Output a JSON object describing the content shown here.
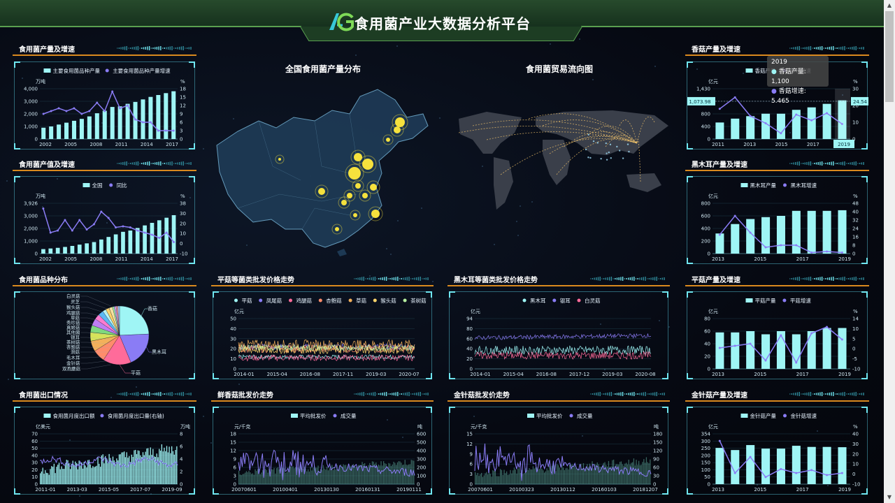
{
  "header": {
    "title": "食用菌产业大数据分析平台"
  },
  "colors": {
    "bar": "#9ff5f5",
    "line": "#8a7cf5",
    "accent": "#d9891e",
    "panel": "#5ad2e6"
  },
  "maps": {
    "china_title": "全国食用菌产量分布",
    "world_title": "食用菌贸易流向图"
  },
  "tooltip": {
    "year": "2019",
    "l1": "香菇产量: 1,100",
    "l2": "香菇增速: 5.465"
  },
  "chart_data": [
    {
      "id": "p1",
      "type": "bar",
      "section": "食用菌产量及增速",
      "legend": [
        "主要食用菌品种产量",
        "主要食用菌品种产量增速"
      ],
      "ylabel_left": "万吨",
      "ylabel_right": "%",
      "ymax": 4000,
      "yticks": [
        "4,000",
        "3,000",
        "2,000",
        "1,000",
        "0"
      ],
      "y2ticks": [
        "18",
        "15",
        "12",
        "9",
        "6",
        "3",
        "0"
      ],
      "y2min": 0,
      "y2max": 18,
      "xticks": [
        "2002",
        "2005",
        "2008",
        "2011",
        "2014",
        "2017"
      ],
      "bars": [
        900,
        1000,
        1150,
        1300,
        1450,
        1600,
        1800,
        2050,
        2250,
        2550,
        2600,
        2800,
        2950,
        3150,
        3350,
        3500,
        3650,
        3800
      ],
      "line": [
        9,
        10,
        11,
        10,
        11,
        9,
        10,
        13,
        10,
        17,
        11,
        12,
        7,
        6,
        6,
        3,
        3,
        3
      ]
    },
    {
      "id": "p2",
      "type": "bar",
      "section": "食用菌产值及增速",
      "legend": [
        "全国",
        "同比"
      ],
      "ylabel_left": "万吨",
      "ylabel_right": "%",
      "ymax": 3926,
      "yticks": [
        "3,926",
        "3,000",
        "2,000",
        "1,000",
        "0"
      ],
      "y2ticks": [
        "38",
        "30",
        "20",
        "10",
        "0",
        "-10"
      ],
      "y2min": -10,
      "y2max": 38,
      "xticks": [
        "2002",
        "2005",
        "2008",
        "2011",
        "2014",
        "2017"
      ],
      "bars": [
        350,
        400,
        450,
        520,
        600,
        700,
        800,
        900,
        1100,
        1300,
        1500,
        1700,
        1800,
        2000,
        2200,
        2400,
        2600,
        2800,
        3000
      ],
      "line": [
        33,
        10,
        12,
        22,
        12,
        22,
        13,
        18,
        30,
        24,
        15,
        16,
        15,
        12,
        10,
        8,
        5,
        10,
        1
      ]
    },
    {
      "id": "p3",
      "type": "bar",
      "section": "香菇产量及增速",
      "legend": [
        "香菇产量",
        "香菇增速"
      ],
      "ylabel_left": "亿元",
      "ylabel_right": "%",
      "ymax": 1430,
      "yticks": [
        "1,430",
        "1,200",
        "800",
        "400",
        "0"
      ],
      "y2ticks": [
        "30",
        "20",
        "10",
        "0"
      ],
      "y2min": -5,
      "y2max": 30,
      "xticks": [
        "2011",
        "2013",
        "2015",
        "2017",
        "2019"
      ],
      "bars": [
        470,
        580,
        650,
        720,
        720,
        830,
        900,
        1000,
        1100
      ],
      "line": [
        16,
        24,
        11,
        6,
        -1,
        12,
        8,
        13,
        5.465
      ],
      "marks": [
        "1,073.98",
        "24.54",
        "2019"
      ]
    },
    {
      "id": "p4",
      "type": "bar",
      "section": "黑木耳产量及增速",
      "legend": [
        "黑木耳产量",
        "黑木耳增速"
      ],
      "ylabel_left": "亿元",
      "ylabel_right": "%",
      "ymax": 800,
      "yticks": [
        "800",
        "600",
        "400",
        "200",
        "0"
      ],
      "y2ticks": [
        "48",
        "40",
        "32",
        "24",
        "16",
        "8",
        "0"
      ],
      "y2min": 0,
      "y2max": 48,
      "xticks": [
        "2013",
        "2015",
        "2017",
        "2019"
      ],
      "bars": [
        320,
        470,
        550,
        580,
        600,
        680,
        680,
        680,
        690
      ],
      "line": [
        18,
        36,
        20,
        6,
        8,
        8,
        1,
        2,
        1
      ]
    },
    {
      "id": "p5",
      "type": "bar",
      "section": "平菇产量及增速",
      "legend": [
        "平菇产量",
        "平菇增速"
      ],
      "ylabel_left": "亿元",
      "ylabel_right": "%",
      "ymax": 80,
      "yticks": [
        "80",
        "60",
        "40",
        "20",
        "0"
      ],
      "y2ticks": [
        "14",
        "10",
        "5",
        "0",
        "-5",
        "-10"
      ],
      "y2min": -10,
      "y2max": 14,
      "xticks": [
        "2013",
        "2015",
        "2017",
        "2019"
      ],
      "bars": [
        58,
        58,
        60,
        55,
        60,
        55,
        60,
        65,
        65
      ],
      "line": [
        0,
        1,
        2,
        -6,
        6,
        -7,
        7,
        10,
        4
      ]
    },
    {
      "id": "p6",
      "type": "bar",
      "section": "金针菇产量及增速",
      "legend": [
        "金针菇产量",
        "金针菇增速"
      ],
      "ylabel_left": "亿元",
      "ylabel_right": "%",
      "ymax": 354,
      "yticks": [
        "354",
        "300",
        "250",
        "200",
        "150",
        "100",
        "50",
        "0"
      ],
      "y2ticks": [
        "40",
        "30",
        "20",
        "10",
        "0",
        "-10"
      ],
      "y2min": -10,
      "y2max": 40,
      "xticks": [
        "2013",
        "2015",
        "2017",
        "2019"
      ],
      "bars": [
        255,
        240,
        275,
        250,
        250,
        270,
        262,
        262,
        260
      ],
      "line": [
        33,
        1,
        17,
        -3,
        5,
        1,
        4,
        -1,
        1
      ]
    },
    {
      "id": "p7",
      "type": "pie",
      "section": "食用菌品种分布",
      "slices": [
        {
          "n": "香菇",
          "v": 25,
          "c": "#9ff5f5"
        },
        {
          "n": "黑木耳",
          "v": 20,
          "c": "#8a7cf5"
        },
        {
          "n": "平菇",
          "v": 16,
          "c": "#ff6b9a"
        },
        {
          "n": "双孢蘑菇",
          "v": 7,
          "c": "#ff8c6b"
        },
        {
          "n": "金针菇",
          "v": 6,
          "c": "#f3b05a"
        },
        {
          "n": "毛木耳",
          "v": 5,
          "c": "#d6e35a"
        },
        {
          "n": "滑菇",
          "v": 4,
          "c": "#7fd97f"
        },
        {
          "n": "杏鲍菇",
          "v": 4,
          "c": "#c07cf5"
        },
        {
          "n": "茶树菇",
          "v": 3,
          "c": "#ff7bd1"
        },
        {
          "n": "银耳",
          "v": 3,
          "c": "#5ab8f5"
        },
        {
          "n": "秀珍菇",
          "v": 2,
          "c": "#b7f5f5"
        },
        {
          "n": "草菇",
          "v": 2,
          "c": "#ffd56b"
        },
        {
          "n": "真姬菇",
          "v": 2,
          "c": "#f5e2a0"
        },
        {
          "n": "鸡腿菇",
          "v": 1,
          "c": "#a0f5b7"
        },
        {
          "n": "猴头菇",
          "v": 1,
          "c": "#d0a0f5"
        },
        {
          "n": "灵芝",
          "v": 1,
          "c": "#f5a0a0"
        },
        {
          "n": "白灵菇",
          "v": 1,
          "c": "#a0c8f5"
        }
      ],
      "labels": [
        "白灵菇",
        "灵芝",
        "猴头菇",
        "鸡腿菇",
        "草菇",
        "秀珍菇",
        "真姬菇",
        "其他菌",
        "银耳",
        "茶树菇",
        "杏鲍菇",
        "滑菇",
        "毛木耳",
        "金针菇",
        "双孢蘑菇"
      ]
    },
    {
      "id": "p8",
      "type": "line",
      "section": "平菇等菌类批发价格走势",
      "legend": [
        "平菇",
        "凤尾菇",
        "鸡腿菇",
        "杏鲍菇",
        "草菇",
        "猴头菇",
        "茶树菇"
      ],
      "legend_colors": [
        "#9ff5f5",
        "#8a7cf5",
        "#ff6b9a",
        "#ff8c6b",
        "#f3b05a",
        "#ffd56b",
        "#b7f0a0"
      ],
      "ylabel": "亿元",
      "ymax": 50,
      "yticks": [
        "50",
        "40",
        "30",
        "20",
        "10",
        "0"
      ],
      "xticks": [
        "2014-01",
        "2015-04",
        "2016-08",
        "2017-11",
        "2019-03",
        "2020-07"
      ],
      "levels": [
        12,
        22,
        11,
        20,
        24,
        19,
        21
      ],
      "noise": [
        2,
        3,
        3,
        4,
        5,
        4,
        3
      ]
    },
    {
      "id": "p9",
      "type": "line",
      "section": "黑木耳等菌类批发价格走势",
      "legend": [
        "黑木耳",
        "银耳",
        "白灵菇"
      ],
      "legend_colors": [
        "#9ff5f5",
        "#8a7cf5",
        "#ff6b9a"
      ],
      "ylabel": "亿元",
      "ymax": 94,
      "yticks": [
        "94",
        "80",
        "60",
        "40",
        "20",
        "0"
      ],
      "xticks": [
        "2014-01",
        "2015-04",
        "2016-08",
        "2017-12",
        "2019-03",
        "2020-08"
      ],
      "levels": [
        35,
        58,
        25
      ],
      "noise": [
        8,
        4,
        7
      ]
    },
    {
      "id": "p10",
      "type": "combo",
      "section": "食用菌出口情况",
      "legend": [
        "食用菌月度出口额",
        "食用菌月度出口量(右轴)"
      ],
      "ylabel_left": "亿美元",
      "ylabel_right": "万吨",
      "ymax": 70,
      "yticks": [
        "70",
        "60",
        "50",
        "40",
        "30",
        "20",
        "10",
        "0"
      ],
      "y2ticks": [
        "8",
        "6",
        "4",
        "2",
        "0"
      ],
      "y2max": 8,
      "xticks": [
        "2011-01",
        "2013-03",
        "2015-05",
        "2017-07",
        "2019-09"
      ],
      "n": 110,
      "bar_base": 20,
      "bar_growth": 30,
      "line_base": 3.5,
      "line_amp": 1
    },
    {
      "id": "p11",
      "type": "combo",
      "section": "鲜香菇批发价走势",
      "legend": [
        "平均批发价",
        "成交量"
      ],
      "ylabel_left": "元/千克",
      "ylabel_right": "吨",
      "ymax": 18,
      "yticks": [
        "18",
        "15",
        "12",
        "9",
        "6",
        "3",
        "0"
      ],
      "y2ticks": [
        "600",
        "500",
        "400",
        "300",
        "200",
        "100",
        "0"
      ],
      "y2max": 600,
      "xticks": [
        "20070601",
        "20100401",
        "20130130",
        "20160131",
        "20190111"
      ],
      "n": 140,
      "bar_base": 4,
      "bar_growth": 4,
      "line_base": 300,
      "line_amp": 250,
      "line_decay": true
    },
    {
      "id": "p12",
      "type": "combo",
      "section": "金针菇批发价走势",
      "legend": [
        "平均批发价",
        "成交量"
      ],
      "ylabel_left": "元/千克",
      "ylabel_right": "吨",
      "ymax": 15,
      "yticks": [
        "15",
        "12",
        "9",
        "6",
        "3",
        "0"
      ],
      "y2ticks": [
        "180",
        "150",
        "120",
        "90",
        "60",
        "30",
        "0"
      ],
      "y2max": 180,
      "xticks": [
        "20070601",
        "20100323",
        "20130112",
        "20160103",
        "20181207"
      ],
      "n": 140,
      "bar_base": 3,
      "bar_growth": 4,
      "line_base": 90,
      "line_amp": 70,
      "line_decay": true
    }
  ]
}
